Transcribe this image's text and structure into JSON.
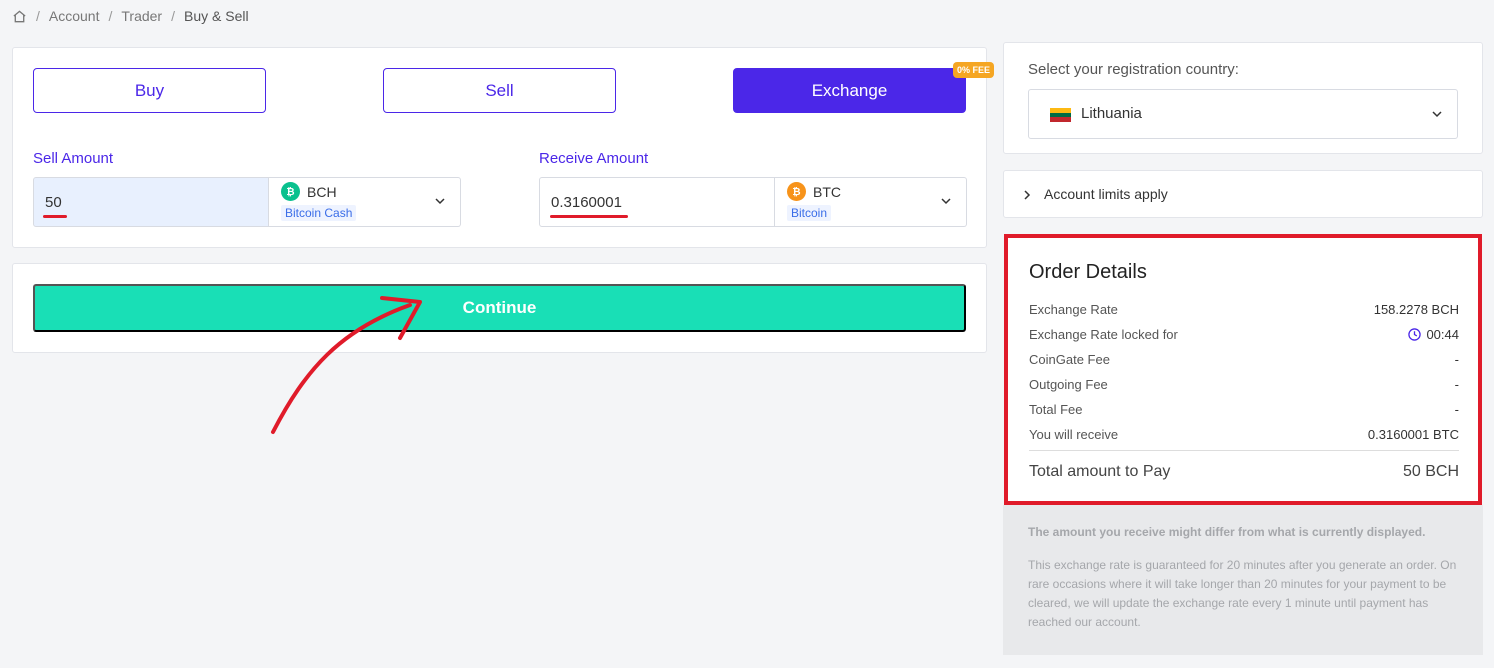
{
  "breadcrumb": {
    "items": [
      "Account",
      "Trader",
      "Buy & Sell"
    ],
    "separator": "/"
  },
  "tabs": {
    "buy": "Buy",
    "sell": "Sell",
    "exchange": "Exchange",
    "exchange_badge": "0% FEE",
    "active": "exchange"
  },
  "sell": {
    "label": "Sell Amount",
    "amount": "50",
    "currency_code": "BCH",
    "currency_name": "Bitcoin Cash",
    "icon": "bitcoin-cash-icon"
  },
  "receive": {
    "label": "Receive Amount",
    "amount": "0.3160001",
    "currency_code": "BTC",
    "currency_name": "Bitcoin",
    "icon": "bitcoin-icon"
  },
  "continue_label": "Continue",
  "country": {
    "label": "Select your registration country:",
    "selected": "Lithuania",
    "flag_colors": [
      "#fdb913",
      "#006a44",
      "#c1272d"
    ]
  },
  "limits": {
    "label": "Account limits apply"
  },
  "order": {
    "title": "Order Details",
    "rows": [
      {
        "label": "Exchange Rate",
        "value": "158.2278 BCH"
      },
      {
        "label": "Exchange Rate locked for",
        "value": "00:44"
      },
      {
        "label": "CoinGate Fee",
        "value": "-"
      },
      {
        "label": "Outgoing Fee",
        "value": "-"
      },
      {
        "label": "Total Fee",
        "value": "-"
      },
      {
        "label": "You will receive",
        "value": "0.3160001 BTC"
      }
    ],
    "total_label": "Total amount to Pay",
    "total_value": "50 BCH"
  },
  "info": {
    "bold": "The amount you receive might differ from what is currently displayed.",
    "text": "This exchange rate is guaranteed for 20 minutes after you generate an order. On rare occasions where it will take longer than 20 minutes for your payment to be cleared, we will update the exchange rate every 1 minute until payment has reached our account."
  },
  "colors": {
    "accent": "#4b27e8",
    "continue": "#19dfb6",
    "highlight": "#e01b2a",
    "bch": "#0ac18e",
    "btc": "#f7931a"
  }
}
